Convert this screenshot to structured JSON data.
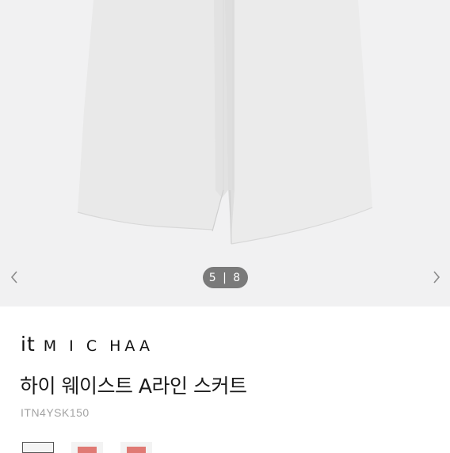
{
  "gallery": {
    "counter": "5 | 8",
    "bg_color": "#f1f1f2",
    "prev_icon": "chevron-left-icon",
    "next_icon": "chevron-right-icon"
  },
  "product": {
    "brand_prefix": "it",
    "brand_name": "MICHAA",
    "brand_rest": "M I C HAA",
    "title": "하이 웨이스트 A라인 스커트",
    "code": "ITN4YSK150"
  },
  "colors": {
    "swatches": [
      {
        "name": "white",
        "color": "#f4f4f4",
        "selected": true
      },
      {
        "name": "red",
        "color": "#e07a74",
        "selected": false
      },
      {
        "name": "red",
        "color": "#e07a74",
        "selected": false
      }
    ]
  }
}
